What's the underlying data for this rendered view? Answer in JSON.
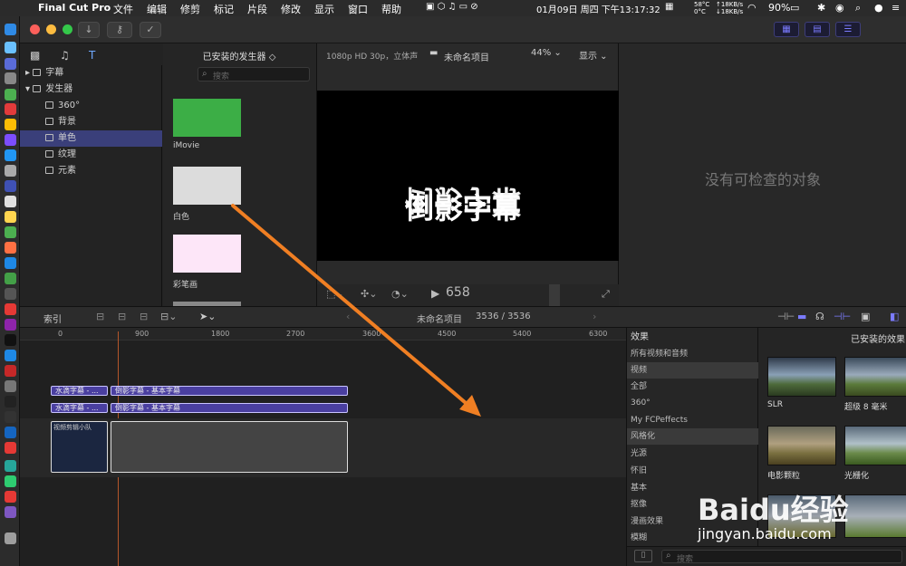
{
  "menubar": {
    "app": "Final Cut Pro",
    "items": [
      "文件",
      "编辑",
      "修剪",
      "标记",
      "片段",
      "修改",
      "显示",
      "窗口",
      "帮助"
    ],
    "temp": "58°C",
    "temp2": "0°C",
    "net_up": "↑18KB/s",
    "net_down": "↓18KB/s",
    "datetime": "01月09日 周四 下午13:17:32",
    "battery": "90%"
  },
  "browser": {
    "generators_title": "已安装的发生器 ◇",
    "search_placeholder": "搜索",
    "sidebar": [
      {
        "label": "字幕",
        "expanded": false,
        "indent": 0,
        "selected": false
      },
      {
        "label": "发生器",
        "expanded": true,
        "indent": 0,
        "selected": false
      },
      {
        "label": "360°",
        "indent": 1,
        "selected": false
      },
      {
        "label": "背景",
        "indent": 1,
        "selected": false
      },
      {
        "label": "单色",
        "indent": 1,
        "selected": true
      },
      {
        "label": "纹理",
        "indent": 1,
        "selected": false
      },
      {
        "label": "元素",
        "indent": 1,
        "selected": false
      }
    ],
    "thumbnails": [
      {
        "label": "iMovie",
        "color": "#3cae46"
      },
      {
        "label": "白色",
        "color": "#dcdcdc"
      },
      {
        "label": "彩笔画",
        "color": "#fde6f8"
      },
      {
        "label": "",
        "color": "#888888"
      }
    ]
  },
  "viewer": {
    "format": "1080p HD 30p，立体声",
    "project": "未命名项目",
    "zoom": "44% ⌄",
    "display": "显示 ⌄",
    "title_text": "倒影字幕",
    "reflection_text": "倒影字幕",
    "timecode": "658"
  },
  "inspector": {
    "empty_text": "没有可检查的对象"
  },
  "timeline_bar": {
    "index": "索引",
    "project": "未命名项目",
    "duration": "3536 / 3536"
  },
  "timeline": {
    "ruler": [
      "0",
      "900",
      "1800",
      "2700",
      "3600",
      "4500",
      "5400",
      "6300"
    ],
    "clips_row1": [
      "水滴字幕 - ...",
      "倒影字幕 - 基本字幕"
    ],
    "clips_row2": [
      "水滴字幕 - ...",
      "倒影字幕 - 基本字幕"
    ],
    "video_clip": "视频剪辑小队"
  },
  "effects": {
    "header": "效果",
    "installed": "已安装的效果",
    "categories": [
      "所有视频和音频",
      "视频",
      "全部",
      "360°",
      "My FCPeffects",
      "风格化",
      "光源",
      "怀旧",
      "基本",
      "抠像",
      "漫画效果",
      "模糊"
    ],
    "thumbs": [
      {
        "label": "SLR"
      },
      {
        "label": "超级 8 毫米"
      },
      {
        "label": "电影颗粒"
      },
      {
        "label": "光栅化"
      }
    ],
    "search_placeholder": "搜索"
  },
  "watermark": {
    "text": "Baidu经验",
    "url": "jingyan.baidu.com"
  },
  "colors": {
    "accent": "#3a3f7a",
    "clip": "#4a3fa0",
    "arrow": "#f07f23"
  }
}
